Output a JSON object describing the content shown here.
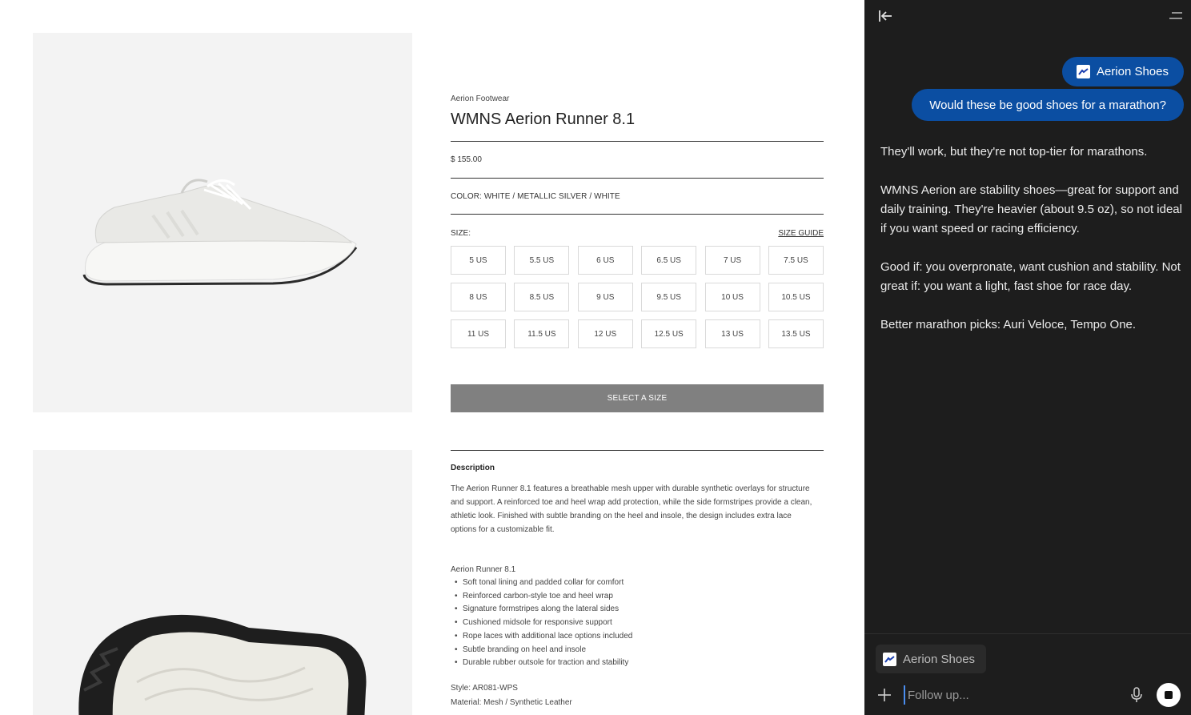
{
  "product": {
    "brand": "Aerion Footwear",
    "title": "WMNS Aerion Runner 8.1",
    "price": "$ 155.00",
    "color": "COLOR: WHITE / METALLIC SILVER / WHITE",
    "size_label": "SIZE:",
    "size_guide": "SIZE GUIDE",
    "sizes": [
      "5 US",
      "5.5 US",
      "6 US",
      "6.5 US",
      "7 US",
      "7.5 US",
      "8 US",
      "8.5 US",
      "9 US",
      "9.5 US",
      "10 US",
      "10.5 US",
      "11 US",
      "11.5 US",
      "12 US",
      "12.5 US",
      "13 US",
      "13.5 US"
    ],
    "select_button": "SELECT A SIZE",
    "description_title": "Description",
    "description": "The Aerion Runner 8.1 features a breathable mesh upper with durable synthetic overlays for structure and support. A reinforced toe and heel wrap add protection, while the side formstripes provide a clean, athletic look. Finished with subtle branding on the heel and insole, the design includes extra lace options for a customizable fit.",
    "features_title": "Aerion Runner 8.1",
    "features": [
      "Soft tonal lining and padded collar for comfort",
      "Reinforced carbon-style toe and heel wrap",
      "Signature formstripes along the lateral sides",
      "Cushioned midsole for responsive support",
      "Rope laces with additional lace options included",
      "Subtle branding on heel and insole",
      "Durable rubber outsole for traction and stability"
    ],
    "style": "Style: AR081-WPS",
    "material": "Material: Mesh / Synthetic Leather"
  },
  "assistant": {
    "context_chip": "Aerion Shoes",
    "question": "Would these be good shoes for a marathon?",
    "answer": [
      "They'll work, but they're not top-tier for marathons.",
      "WMNS Aerion are stability shoes—great for support and daily training. They're heavier (about 9.5 oz), so not ideal if you want speed or racing efficiency.",
      "Good if: you overpronate, want cushion and stability. Not great if: you want a light, fast shoe for race day.",
      "Better marathon picks: Auri Veloce, Tempo One."
    ],
    "footer_chip": "Aerion Shoes",
    "input_placeholder": "Follow up..."
  },
  "icons": {
    "collapse": "collapse-panel-icon",
    "menu": "menu-icon",
    "logo": "aerion-logo-icon",
    "plus": "plus-icon",
    "mic": "microphone-icon",
    "stop": "stop-icon"
  },
  "colors": {
    "panel_bg": "#1d1d1d",
    "bubble_bg": "#0b4ea2",
    "select_button_bg": "#808080",
    "image_bg": "#f3f3f3"
  }
}
